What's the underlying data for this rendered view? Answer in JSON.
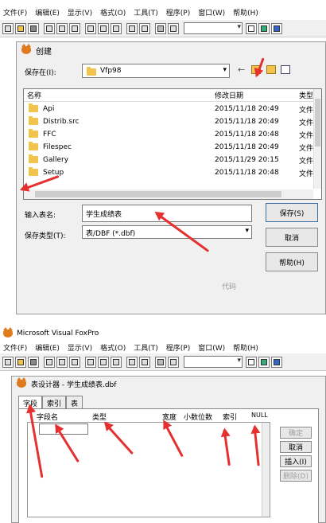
{
  "menu": [
    "文件(F)",
    "编辑(E)",
    "显示(V)",
    "格式(O)",
    "工具(T)",
    "程序(P)",
    "窗口(W)",
    "帮助(H)"
  ],
  "save_dialog": {
    "title": "创建",
    "save_in_label": "保存在(I):",
    "save_in_value": "Vfp98",
    "columns": {
      "name": "名称",
      "date": "修改日期",
      "type": "类型"
    },
    "files": [
      {
        "name": "Api",
        "date": "2015/11/18 20:49",
        "type": "文件"
      },
      {
        "name": "Distrib.src",
        "date": "2015/11/18 20:49",
        "type": "文件"
      },
      {
        "name": "FFC",
        "date": "2015/11/18 20:48",
        "type": "文件"
      },
      {
        "name": "Filespec",
        "date": "2015/11/18 20:49",
        "type": "文件"
      },
      {
        "name": "Gallery",
        "date": "2015/11/29 20:15",
        "type": "文件"
      },
      {
        "name": "Setup",
        "date": "2015/11/18 20:48",
        "type": "文件"
      }
    ],
    "filename_label": "输入表名:",
    "filename_value": "学生成绩表",
    "filetype_label": "保存类型(T):",
    "filetype_value": "表/DBF (*.dbf)",
    "save_button": "保存(S)",
    "cancel_button": "取消",
    "help_button": "帮助(H)",
    "code_page": "代码"
  },
  "vfp_window_title": "Microsoft Visual FoxPro",
  "table_designer": {
    "title": "表设计器 - 学生成绩表.dbf",
    "tabs": [
      "字段",
      "索引",
      "表"
    ],
    "columns": [
      "字段名",
      "类型",
      "宽度",
      "小数位数",
      "索引",
      "NULL"
    ],
    "ok_button": "确定",
    "cancel_button": "取消",
    "insert_button": "插入(I)",
    "delete_button": "删除(D)"
  }
}
